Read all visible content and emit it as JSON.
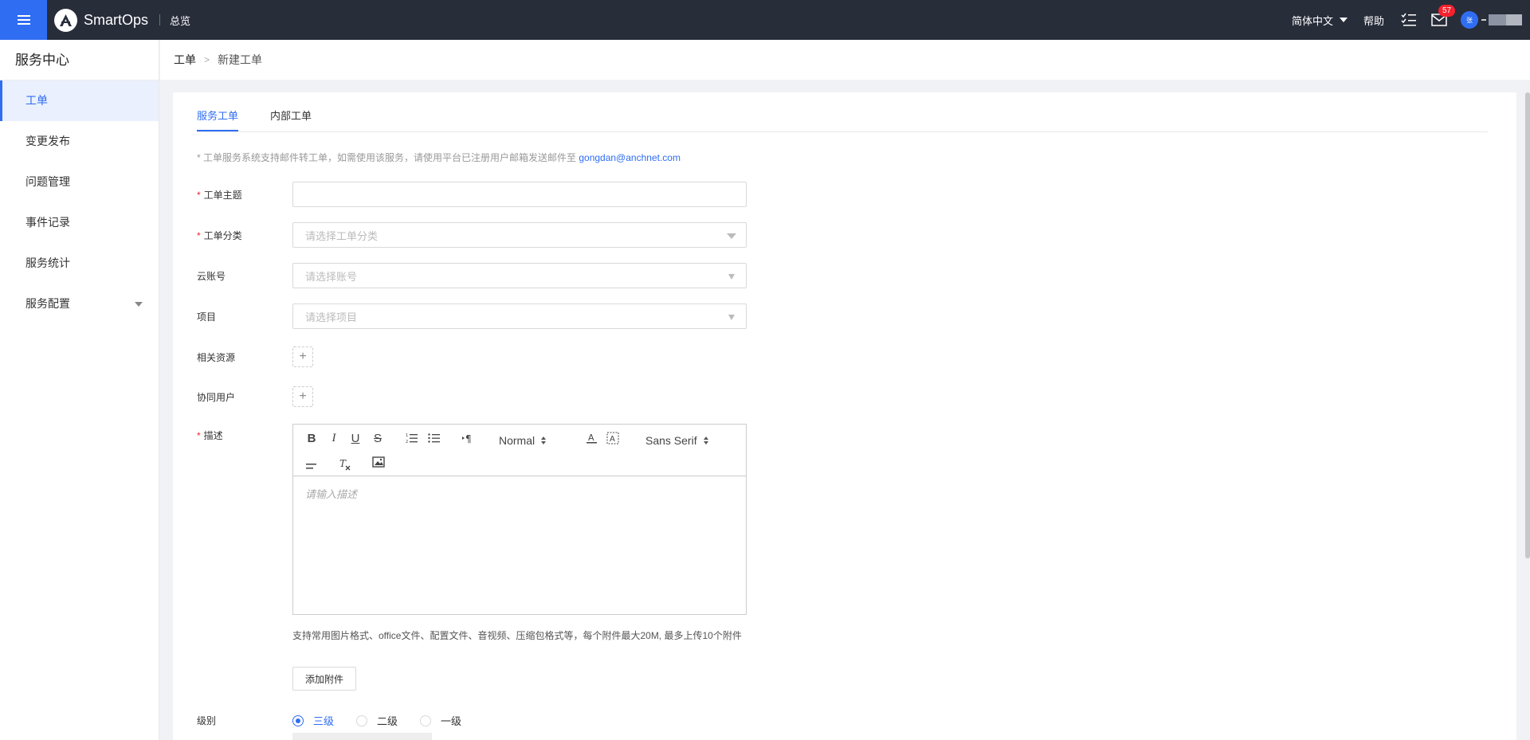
{
  "topbar": {
    "logo_text": "SmartOps",
    "overview": "总览",
    "language": "简体中文",
    "help": "帮助",
    "mail_badge": "57",
    "avatar_text": "张",
    "accent": "#2f6df3"
  },
  "sidebar": {
    "title": "服务中心",
    "items": [
      {
        "label": "工单"
      },
      {
        "label": "变更发布"
      },
      {
        "label": "问题管理"
      },
      {
        "label": "事件记录"
      },
      {
        "label": "服务统计"
      },
      {
        "label": "服务配置"
      }
    ]
  },
  "breadcrumb": {
    "root": "工单",
    "current": "新建工单"
  },
  "tabs": [
    {
      "label": "服务工单"
    },
    {
      "label": "内部工单"
    }
  ],
  "notice": {
    "text": "* 工单服务系统支持邮件转工单，如需使用该服务，请使用平台已注册用户邮箱发送邮件至 ",
    "email": "gongdan@anchnet.com"
  },
  "form": {
    "subject": {
      "label": "工单主题",
      "value": ""
    },
    "category": {
      "label": "工单分类",
      "placeholder": "请选择工单分类"
    },
    "account": {
      "label": "云账号",
      "placeholder": "请选择账号"
    },
    "project": {
      "label": "项目",
      "placeholder": "请选择项目"
    },
    "resources": {
      "label": "相关资源"
    },
    "collaborators": {
      "label": "协同用户"
    },
    "description": {
      "label": "描述",
      "placeholder": "请输入描述",
      "toolbar": {
        "bold": "B",
        "italic": "I",
        "underline": "U",
        "strike": "S",
        "header": "Normal",
        "font": "Sans Serif"
      }
    },
    "attachment_note": "支持常用图片格式、office文件、配置文件、音视频、压缩包格式等，每个附件最大20M, 最多上传10个附件",
    "attachment_button": "添加附件",
    "level": {
      "label": "级别",
      "options": [
        {
          "label": "三级",
          "checked": true
        },
        {
          "label": "二级",
          "checked": false
        },
        {
          "label": "一级",
          "checked": false
        }
      ]
    }
  }
}
